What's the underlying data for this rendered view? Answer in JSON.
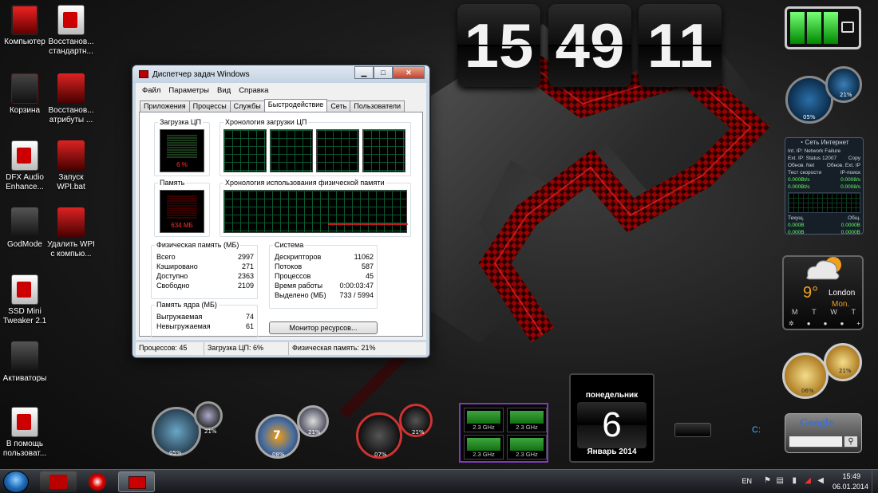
{
  "desktop_icons": [
    {
      "label": "Компьютер"
    },
    {
      "label": "Восстанов... стандартн..."
    },
    {
      "label": "Корзина"
    },
    {
      "label": "Восстанов... атрибуты ..."
    },
    {
      "label": "DFX Audio Enhance..."
    },
    {
      "label": "Запуск WPI.bat"
    },
    {
      "label": "GodMode"
    },
    {
      "label": "Удалить WPI с компью..."
    },
    {
      "label": "SSD Mini Tweaker 2.1"
    },
    {
      "label": "Активаторы"
    },
    {
      "label": "В помощь пользоват..."
    }
  ],
  "clock": {
    "hours": "15",
    "minutes": "49",
    "seconds": "11"
  },
  "task_manager": {
    "title": "Диспетчер задач Windows",
    "window_buttons": {
      "minimize": "▁",
      "maximize": "□",
      "close": "✕"
    },
    "menu": [
      "Файл",
      "Параметры",
      "Вид",
      "Справка"
    ],
    "tabs": [
      "Приложения",
      "Процессы",
      "Службы",
      "Быстродействие",
      "Сеть",
      "Пользователи"
    ],
    "active_tab": 3,
    "cpu_usage": {
      "caption": "Загрузка ЦП",
      "value": "6 %",
      "level": 0.06
    },
    "cpu_history": {
      "caption": "Хронология загрузки ЦП"
    },
    "memory": {
      "caption": "Память",
      "value": "634 МБ"
    },
    "memory_history": {
      "caption": "Хронология использования физической памяти"
    },
    "physical_memory": {
      "caption": "Физическая память (МБ)",
      "rows": [
        {
          "k": "Всего",
          "v": "2997"
        },
        {
          "k": "Кэшировано",
          "v": "271"
        },
        {
          "k": "Доступно",
          "v": "2363"
        },
        {
          "k": "Свободно",
          "v": "2109"
        }
      ]
    },
    "kernel_memory": {
      "caption": "Память ядра (МБ)",
      "rows": [
        {
          "k": "Выгружаемая",
          "v": "74"
        },
        {
          "k": "Невыгружаемая",
          "v": "61"
        }
      ]
    },
    "system": {
      "caption": "Система",
      "rows": [
        {
          "k": "Дескрипторов",
          "v": "11062"
        },
        {
          "k": "Потоков",
          "v": "587"
        },
        {
          "k": "Процессов",
          "v": "45"
        },
        {
          "k": "Время работы",
          "v": "0:00:03:47"
        },
        {
          "k": "Выделено (МБ)",
          "v": "733 / 5994"
        }
      ]
    },
    "resource_monitor_button": "Монитор ресурсов...",
    "status": {
      "processes": "Процессов: 45",
      "cpu": "Загрузка ЦП: 6%",
      "memory": "Физическая память: 21%"
    }
  },
  "gauges_top": {
    "left": "05%",
    "right": "21%"
  },
  "network": {
    "title": "Сеть Интернет",
    "int_ip": "Int. IP:  Network Failure",
    "ext_ip": "Ext. IP:  Status 12007",
    "copy": "Copy",
    "refresh_net": "Обнов. Net",
    "refresh_ext": "Обнов. Ext. IP",
    "speed_test": "Тест скорости",
    "ip_search": "IP-поиск",
    "up_rate": "0.000Bt/s",
    "down_rate": "0.000Bt/s",
    "up_rate2": "0.0008/s",
    "down_rate2": "0.0008/s",
    "current": "Текущ.",
    "total": "Общ.",
    "cur_up": "0.000B",
    "cur_down": "0.000B",
    "tot_up": "0.0000B",
    "tot_down": "0.0000B"
  },
  "weather": {
    "temp": "9°",
    "city": "London",
    "day": "Mon.",
    "days": [
      "M",
      "T",
      "W",
      "T"
    ]
  },
  "gauges_bottom_right": {
    "left": "06%",
    "right": "21%"
  },
  "dock_gadgets": [
    {
      "a": "05%",
      "b": "21%"
    },
    {
      "a": "08%",
      "b": "21%",
      "center": "7"
    },
    {
      "a": "07%",
      "b": "21%"
    }
  ],
  "cpu_meter": {
    "cores": [
      "2.3 GHz",
      "2.3 GHz",
      "2.3 GHz",
      "2.3 GHz"
    ]
  },
  "calendar": {
    "weekday": "понедельник",
    "day": "6",
    "month_year": "Январь 2014"
  },
  "drive": {
    "letter": "C:"
  },
  "google": {
    "logo": "Google"
  },
  "taskbar": {
    "language": "EN",
    "time": "15:49",
    "date": "06.01.2014"
  },
  "colors": {
    "accent_red": "#e01010",
    "graph_green": "#18c040",
    "cpu_purple": "#7c3bb3"
  }
}
